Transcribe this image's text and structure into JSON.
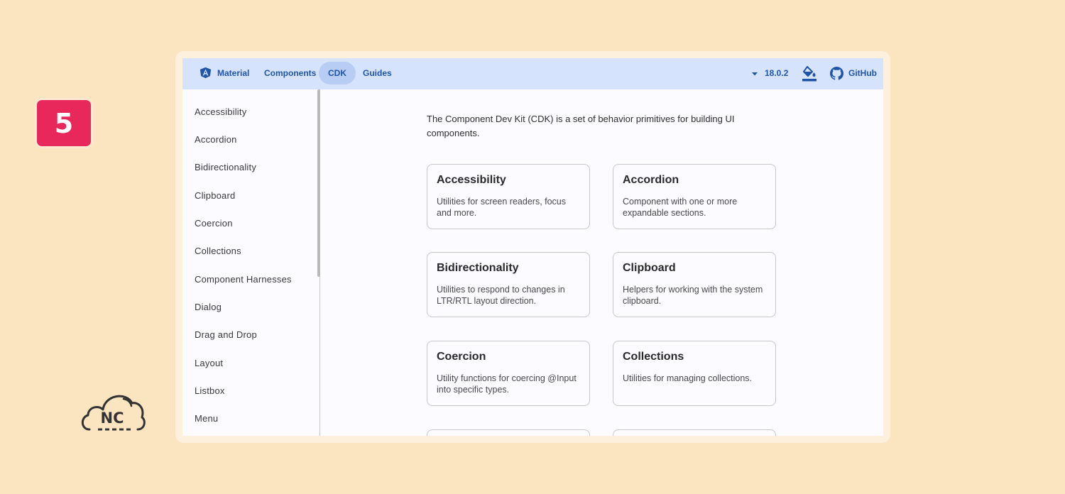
{
  "badge": {
    "number": "5"
  },
  "logo": {
    "text": "NC"
  },
  "navbar": {
    "items": [
      {
        "label": "Material",
        "icon": "angular-logo-icon"
      },
      {
        "label": "Components"
      },
      {
        "label": "CDK",
        "active": true
      },
      {
        "label": "Guides"
      }
    ],
    "version": "18.0.2",
    "theme_icon": "format-color-fill-icon",
    "github_label": "GitHub"
  },
  "sidebar": {
    "items": [
      "Accessibility",
      "Accordion",
      "Bidirectionality",
      "Clipboard",
      "Coercion",
      "Collections",
      "Component Harnesses",
      "Dialog",
      "Drag and Drop",
      "Layout",
      "Listbox",
      "Menu"
    ]
  },
  "main": {
    "intro": "The Component Dev Kit (CDK) is a set of behavior primitives for building UI components.",
    "cards": [
      {
        "title": "Accessibility",
        "description": "Utilities for screen readers, focus and more."
      },
      {
        "title": "Accordion",
        "description": "Component with one or more expandable sections."
      },
      {
        "title": "Bidirectionality",
        "description": "Utilities to respond to changes in LTR/RTL layout direction."
      },
      {
        "title": "Clipboard",
        "description": "Helpers for working with the system clipboard."
      },
      {
        "title": "Coercion",
        "description": "Utility functions for coercing @Input into specific types."
      },
      {
        "title": "Collections",
        "description": "Utilities for managing collections."
      },
      {
        "title": "",
        "description": ""
      },
      {
        "title": "",
        "description": ""
      }
    ]
  },
  "colors": {
    "background": "#fbe4c0",
    "badge": "#e8285a",
    "navbar": "#d6e3fd",
    "nav_text": "#1f55a8",
    "active_pill": "#b8cdf3"
  }
}
